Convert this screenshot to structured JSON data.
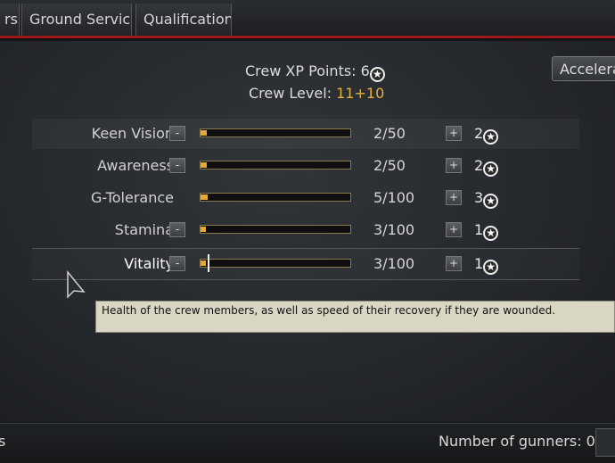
{
  "tabs": [
    {
      "label": "rs"
    },
    {
      "label": "Ground Service"
    },
    {
      "label": "Qualification"
    }
  ],
  "xp": {
    "points_label": "Crew XP Points: ",
    "points_value": "6",
    "level_label": "Crew Level: ",
    "level_value": "11",
    "level_bonus": "+10"
  },
  "accelerate_button": "Accelera",
  "star_glyph": "★",
  "skills": [
    {
      "name": "Keen Vision",
      "value": "2/50",
      "fraction": 0.04,
      "cost": "2",
      "minus": "-",
      "plus": "+",
      "has_minus": true
    },
    {
      "name": "Awareness",
      "value": "2/50",
      "fraction": 0.04,
      "cost": "2",
      "minus": "-",
      "plus": "+",
      "has_minus": true
    },
    {
      "name": "G-Tolerance",
      "value": "5/100",
      "fraction": 0.05,
      "cost": "3",
      "minus": "",
      "plus": "+",
      "has_minus": false
    },
    {
      "name": "Stamina",
      "value": "3/100",
      "fraction": 0.03,
      "cost": "1",
      "minus": "-",
      "plus": "+",
      "has_minus": true
    },
    {
      "name": "Vitality",
      "value": "3/100",
      "fraction": 0.03,
      "cost": "1",
      "minus": "-",
      "plus": "+",
      "has_minus": true
    }
  ],
  "tooltip": "Health of the crew members, as well as speed of their recovery if they are wounded.",
  "bottom": {
    "left_text": "s",
    "gunners_label": "Number of gunners: 0"
  },
  "colors": {
    "accent_red": "#9c1a1a",
    "bar_fill": "#e0a93a",
    "bonus_gold": "#e3b23c"
  }
}
